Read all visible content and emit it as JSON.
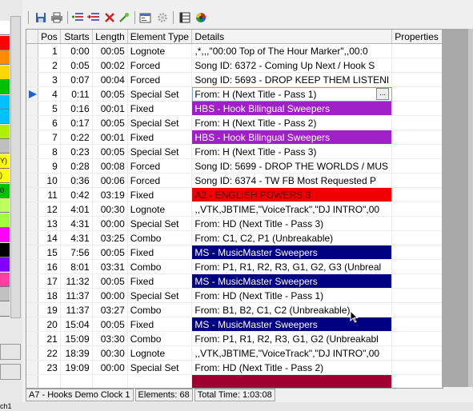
{
  "left_panel": {
    "swatches": [
      {
        "color": "#ffffff",
        "label": ""
      },
      {
        "color": "#ff0000",
        "label": ""
      },
      {
        "color": "#ff8c00",
        "label": ""
      },
      {
        "color": "#ffd700",
        "label": ""
      },
      {
        "color": "#00c000",
        "label": ""
      },
      {
        "color": "#00c0ff",
        "label": ""
      },
      {
        "color": "#00c0ff",
        "label": ""
      },
      {
        "color": "#b0f000",
        "label": ""
      },
      {
        "color": "#bfbfbf",
        "label": ""
      },
      {
        "color": "#ffff00",
        "label": "Y)"
      },
      {
        "color": "#ffff00",
        "label": ")"
      },
      {
        "color": "#00c000",
        "label": "0"
      },
      {
        "color": "#c0ff60",
        "label": ""
      },
      {
        "color": "#a0ff40",
        "label": ""
      },
      {
        "color": "#ff00ff",
        "label": ""
      },
      {
        "color": "#000000",
        "label": ""
      },
      {
        "color": "#8000ff",
        "label": ""
      },
      {
        "color": "#ff40a0",
        "label": ""
      },
      {
        "color": "#c0c0c0",
        "label": ""
      },
      {
        "color": "#e0e0e0",
        "label": ""
      }
    ],
    "bottom_text": "ch1"
  },
  "toolbar": {
    "icons": [
      "save-icon",
      "print-icon",
      "add-element-icon",
      "insert-element-icon",
      "delete-icon",
      "wand-icon",
      "properties-icon",
      "gear-icon",
      "grid-icon",
      "color-wheel-icon"
    ]
  },
  "grid": {
    "columns": [
      "Pos",
      "Starts",
      "Length",
      "Element Type",
      "Details",
      "Properties"
    ],
    "rows": [
      {
        "pos": "1",
        "starts": "0:00",
        "length": "00:05",
        "type": "Lognote",
        "details": ",*,,,\"00:00 Top of The Hour Marker\",,00:0",
        "color": ""
      },
      {
        "pos": "2",
        "starts": "0:05",
        "length": "00:02",
        "type": "Forced",
        "details": "Song ID: 6372 - Coming Up Next / Hook S",
        "color": ""
      },
      {
        "pos": "3",
        "starts": "0:07",
        "length": "00:04",
        "type": "Forced",
        "details": "Song ID: 5693 - DROP KEEP THEM LISTENI",
        "color": ""
      },
      {
        "pos": "4",
        "starts": "0:11",
        "length": "00:05",
        "type": "Special Set",
        "details": "From: H (Next Title - Pass 1)",
        "color": "",
        "current": true
      },
      {
        "pos": "5",
        "starts": "0:16",
        "length": "00:01",
        "type": "Fixed",
        "details": "HBS - Hook Bilingual Sweepers",
        "color": "#a020c8",
        "text_color": "#ffffff"
      },
      {
        "pos": "6",
        "starts": "0:17",
        "length": "00:05",
        "type": "Special Set",
        "details": "From: H (Next Title - Pass 2)",
        "color": ""
      },
      {
        "pos": "7",
        "starts": "0:22",
        "length": "00:01",
        "type": "Fixed",
        "details": "HBS - Hook Bilingual Sweepers",
        "color": "#a020c8",
        "text_color": "#ffffff"
      },
      {
        "pos": "8",
        "starts": "0:23",
        "length": "00:05",
        "type": "Special Set",
        "details": "From: H (Next Title - Pass 3)",
        "color": ""
      },
      {
        "pos": "9",
        "starts": "0:28",
        "length": "00:08",
        "type": "Forced",
        "details": "Song ID: 5699 - DROP THE WORLDS / MUS",
        "color": ""
      },
      {
        "pos": "10",
        "starts": "0:36",
        "length": "00:06",
        "type": "Forced",
        "details": "Song ID: 6374 - TW FB Most Requested P",
        "color": ""
      },
      {
        "pos": "11",
        "starts": "0:42",
        "length": "03:19",
        "type": "Fixed",
        "details": "A2 - ENGLISH POWERS 3",
        "color": "#f00000",
        "text_color": "#600000"
      },
      {
        "pos": "12",
        "starts": "4:01",
        "length": "00:30",
        "type": "Lognote",
        "details": ",,VTK,JBTIME,\"VoiceTrack\",\"DJ INTRO\",00",
        "color": ""
      },
      {
        "pos": "13",
        "starts": "4:31",
        "length": "00:00",
        "type": "Special Set",
        "details": "From: HD (Next Title - Pass 3)",
        "color": ""
      },
      {
        "pos": "14",
        "starts": "4:31",
        "length": "03:25",
        "type": "Combo",
        "details": "From: C1, C2, P1 (Unbreakable)",
        "color": ""
      },
      {
        "pos": "15",
        "starts": "7:56",
        "length": "00:05",
        "type": "Fixed",
        "details": "MS - MusicMaster Sweepers",
        "color": "#000080",
        "text_color": "#ffffff"
      },
      {
        "pos": "16",
        "starts": "8:01",
        "length": "03:31",
        "type": "Combo",
        "details": "From: P1, R1, R2, R3, G1, G2, G3 (Unbreal",
        "color": ""
      },
      {
        "pos": "17",
        "starts": "11:32",
        "length": "00:05",
        "type": "Fixed",
        "details": "MS - MusicMaster Sweepers",
        "color": "#000080",
        "text_color": "#ffffff"
      },
      {
        "pos": "18",
        "starts": "11:37",
        "length": "00:00",
        "type": "Special Set",
        "details": "From: HD (Next Title - Pass 1)",
        "color": ""
      },
      {
        "pos": "19",
        "starts": "11:37",
        "length": "03:27",
        "type": "Combo",
        "details": "From: B1, B2, C1, C2 (Unbreakable)",
        "color": ""
      },
      {
        "pos": "20",
        "starts": "15:04",
        "length": "00:05",
        "type": "Fixed",
        "details": "MS - MusicMaster Sweepers",
        "color": "#000080",
        "text_color": "#ffffff"
      },
      {
        "pos": "21",
        "starts": "15:09",
        "length": "03:30",
        "type": "Combo",
        "details": "From: P1, R1, R2, R3, G1, G2 (Unbreakabl",
        "color": ""
      },
      {
        "pos": "22",
        "starts": "18:39",
        "length": "00:30",
        "type": "Lognote",
        "details": ",,VTK,JBTIME,\"VoiceTrack\",\"DJ INTRO\",00",
        "color": ""
      },
      {
        "pos": "23",
        "starts": "19:09",
        "length": "00:00",
        "type": "Special Set",
        "details": "From: HD (Next Title - Pass 2)",
        "color": ""
      }
    ],
    "partial_row_color": "#a00030"
  },
  "status": {
    "clock": "A7 - Hooks Demo Clock 1",
    "elements": "Elements: 68",
    "total": "Total Time: 1:03:08"
  }
}
